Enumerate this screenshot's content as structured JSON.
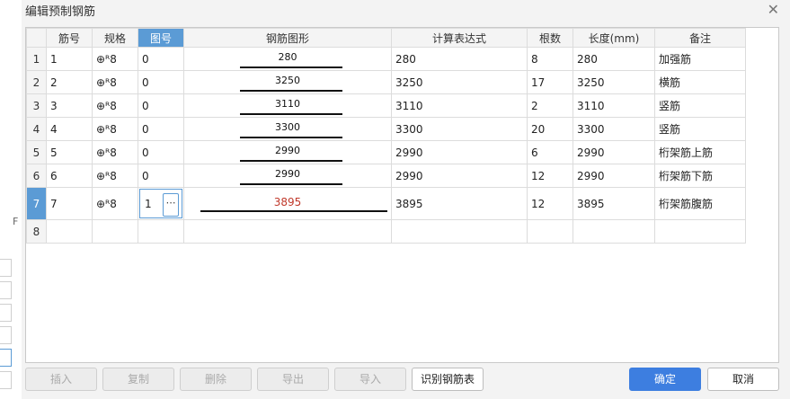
{
  "dialog": {
    "title": "编辑预制钢筋"
  },
  "left_strip": {
    "fragment_text": "F"
  },
  "grid": {
    "columns": [
      "筋号",
      "规格",
      "图号",
      "钢筋图形",
      "计算表达式",
      "根数",
      "长度(mm)",
      "备注"
    ],
    "rows": [
      {
        "num": "1",
        "bar_no": "1",
        "spec": "⊕ᴿ8",
        "fig_no": "0",
        "shape": "280",
        "expr": "280",
        "count": "8",
        "length": "280",
        "note": "加强筋"
      },
      {
        "num": "2",
        "bar_no": "2",
        "spec": "⊕ᴿ8",
        "fig_no": "0",
        "shape": "3250",
        "expr": "3250",
        "count": "17",
        "length": "3250",
        "note": "横筋"
      },
      {
        "num": "3",
        "bar_no": "3",
        "spec": "⊕ᴿ8",
        "fig_no": "0",
        "shape": "3110",
        "expr": "3110",
        "count": "2",
        "length": "3110",
        "note": "竖筋"
      },
      {
        "num": "4",
        "bar_no": "4",
        "spec": "⊕ᴿ8",
        "fig_no": "0",
        "shape": "3300",
        "expr": "3300",
        "count": "20",
        "length": "3300",
        "note": "竖筋"
      },
      {
        "num": "5",
        "bar_no": "5",
        "spec": "⊕ᴿ8",
        "fig_no": "0",
        "shape": "2990",
        "expr": "2990",
        "count": "6",
        "length": "2990",
        "note": "桁架筋上筋"
      },
      {
        "num": "6",
        "bar_no": "6",
        "spec": "⊕ᴿ8",
        "fig_no": "0",
        "shape": "2990",
        "expr": "2990",
        "count": "12",
        "length": "2990",
        "note": "桁架筋下筋"
      },
      {
        "num": "7",
        "bar_no": "7",
        "spec": "⊕ᴿ8",
        "fig_no": "1",
        "shape": "3895",
        "expr": "3895",
        "count": "12",
        "length": "3895",
        "note": "桁架筋腹筋"
      },
      {
        "num": "8",
        "bar_no": "",
        "spec": "",
        "fig_no": "",
        "shape": "",
        "expr": "",
        "count": "",
        "length": "",
        "note": ""
      }
    ],
    "edit_button": "⋯"
  },
  "buttons": {
    "insert": "插入",
    "copy": "复制",
    "delete": "删除",
    "export": "导出",
    "import": "导入",
    "recognize": "识别钢筋表",
    "ok": "确定",
    "cancel": "取消"
  },
  "colors": {
    "accent": "#5b9bd5",
    "primary_button": "#3d7ee0",
    "shape_highlight": "#c0392b"
  }
}
